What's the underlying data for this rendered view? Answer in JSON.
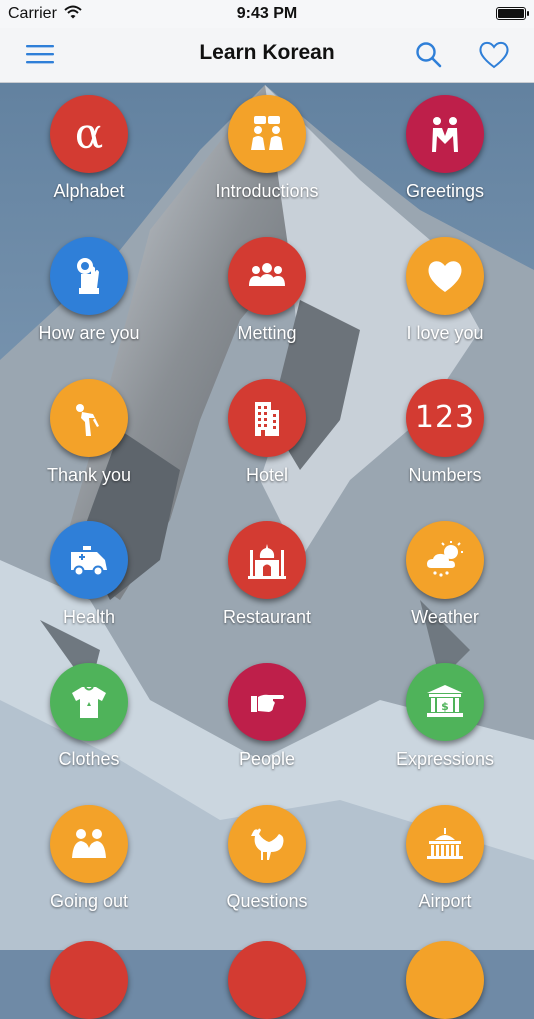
{
  "status_bar": {
    "carrier": "Carrier",
    "time": "9:43 PM"
  },
  "nav": {
    "title": "Learn Korean"
  },
  "colors": {
    "red": "#d33b32",
    "orange": "#f3a229",
    "crimson": "#be1f4a",
    "blue": "#2f7fd8",
    "green": "#4fb35a",
    "accent": "#2f7fd8"
  },
  "categories": [
    {
      "label": "Alphabet",
      "icon": "alpha-icon",
      "color": "red"
    },
    {
      "label": "Introductions",
      "icon": "people-talking-icon",
      "color": "orange"
    },
    {
      "label": "Greetings",
      "icon": "couple-icon",
      "color": "crimson"
    },
    {
      "label": "How are you",
      "icon": "ok-hand-icon",
      "color": "blue"
    },
    {
      "label": "Metting",
      "icon": "group-icon",
      "color": "red"
    },
    {
      "label": "I love you",
      "icon": "heart-icon",
      "color": "orange"
    },
    {
      "label": "Thank you",
      "icon": "bow-icon",
      "color": "orange"
    },
    {
      "label": "Hotel",
      "icon": "building-icon",
      "color": "red"
    },
    {
      "label": "Numbers",
      "icon": "numbers-icon",
      "color": "red"
    },
    {
      "label": "Health",
      "icon": "ambulance-icon",
      "color": "blue"
    },
    {
      "label": "Restaurant",
      "icon": "taj-mahal-icon",
      "color": "red"
    },
    {
      "label": "Weather",
      "icon": "sun-cloud-icon",
      "color": "orange"
    },
    {
      "label": "Clothes",
      "icon": "tshirt-icon",
      "color": "green"
    },
    {
      "label": "People",
      "icon": "pointing-hand-icon",
      "color": "crimson"
    },
    {
      "label": "Expressions",
      "icon": "bank-icon",
      "color": "green"
    },
    {
      "label": "Going out",
      "icon": "friends-icon",
      "color": "orange"
    },
    {
      "label": "Questions",
      "icon": "rooster-icon",
      "color": "orange"
    },
    {
      "label": "Airport",
      "icon": "airport-icon",
      "color": "orange"
    }
  ],
  "glyphs": {
    "alpha": "α",
    "numbers": "123"
  }
}
